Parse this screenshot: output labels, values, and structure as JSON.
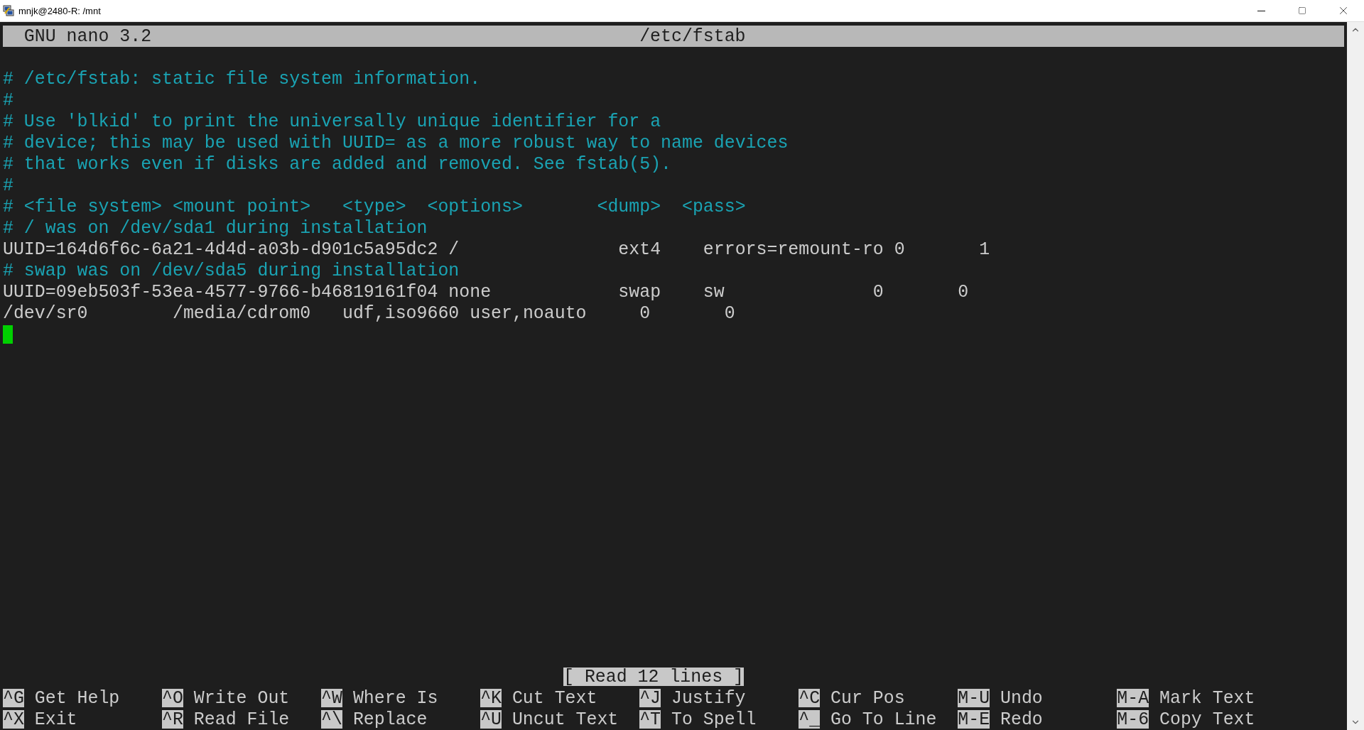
{
  "window": {
    "title": "mnjk@2480-R: /mnt"
  },
  "header": {
    "app": "GNU nano 3.2",
    "file": "/etc/fstab"
  },
  "lines": [
    {
      "kind": "blank"
    },
    {
      "kind": "comment",
      "text": "# /etc/fstab: static file system information."
    },
    {
      "kind": "comment",
      "text": "#"
    },
    {
      "kind": "comment",
      "text": "# Use 'blkid' to print the universally unique identifier for a"
    },
    {
      "kind": "comment",
      "text": "# device; this may be used with UUID= as a more robust way to name devices"
    },
    {
      "kind": "comment",
      "text": "# that works even if disks are added and removed. See fstab(5)."
    },
    {
      "kind": "comment",
      "text": "#"
    },
    {
      "kind": "comment",
      "text": "# <file system> <mount point>   <type>  <options>       <dump>  <pass>"
    },
    {
      "kind": "comment",
      "text": "# / was on /dev/sda1 during installation"
    },
    {
      "kind": "text",
      "text": "UUID=164d6f6c-6a21-4d4d-a03b-d901c5a95dc2 /               ext4    errors=remount-ro 0       1"
    },
    {
      "kind": "comment",
      "text": "# swap was on /dev/sda5 during installation"
    },
    {
      "kind": "text",
      "text": "UUID=09eb503f-53ea-4577-9766-b46819161f04 none            swap    sw              0       0"
    },
    {
      "kind": "text",
      "text": "/dev/sr0        /media/cdrom0   udf,iso9660 user,noauto     0       0"
    },
    {
      "kind": "cursor"
    }
  ],
  "status": "[ Read 12 lines ]",
  "shortcuts": [
    [
      {
        "key": "^G",
        "label": "Get Help"
      },
      {
        "key": "^O",
        "label": "Write Out"
      },
      {
        "key": "^W",
        "label": "Where Is"
      },
      {
        "key": "^K",
        "label": "Cut Text"
      },
      {
        "key": "^J",
        "label": "Justify"
      },
      {
        "key": "^C",
        "label": "Cur Pos"
      },
      {
        "key": "M-U",
        "label": "Undo"
      },
      {
        "key": "M-A",
        "label": "Mark Text"
      }
    ],
    [
      {
        "key": "^X",
        "label": "Exit"
      },
      {
        "key": "^R",
        "label": "Read File"
      },
      {
        "key": "^\\",
        "label": "Replace"
      },
      {
        "key": "^U",
        "label": "Uncut Text"
      },
      {
        "key": "^T",
        "label": "To Spell"
      },
      {
        "key": "^_",
        "label": "Go To Line"
      },
      {
        "key": "M-E",
        "label": "Redo"
      },
      {
        "key": "M-6",
        "label": "Copy Text"
      }
    ]
  ]
}
